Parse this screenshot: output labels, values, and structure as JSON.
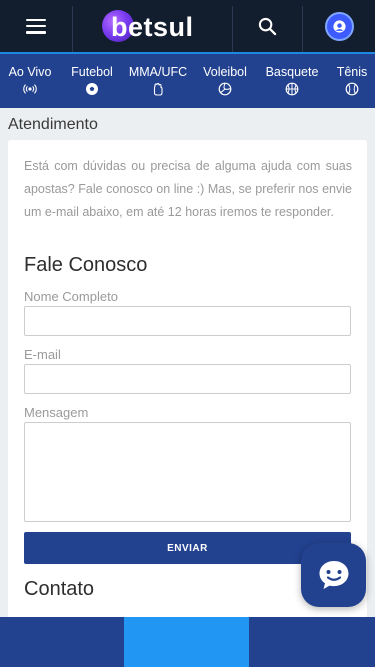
{
  "header": {
    "brand": "betsul",
    "menu_icon": "hamburger-menu-icon",
    "search_icon": "search-icon",
    "avatar_icon": "user-avatar-icon",
    "colors": {
      "background": "#121d2d",
      "accent_line": "#1e88e5",
      "avatar": "#3d5afe"
    }
  },
  "sports_nav": {
    "items": [
      {
        "label": "Ao Vivo",
        "icon": "live-broadcast-icon"
      },
      {
        "label": "Futebol",
        "icon": "soccer-ball-icon"
      },
      {
        "label": "MMA/UFC",
        "icon": "fist-icon"
      },
      {
        "label": "Voleibol",
        "icon": "volleyball-icon"
      },
      {
        "label": "Basquete",
        "icon": "basketball-icon"
      },
      {
        "label": "Tênis",
        "icon": "tennis-ball-icon"
      }
    ],
    "background": "#22418f"
  },
  "page": {
    "heading": "Atendimento",
    "intro": "Está com dúvidas ou precisa de alguma ajuda com suas apostas? Fale conosco on line :) Mas, se preferir nos envie um e-mail abaixo, em até 12 horas iremos te responder.",
    "form": {
      "title": "Fale Conosco",
      "name_label": "Nome Completo",
      "name_value": "",
      "email_label": "E-mail",
      "email_value": "",
      "message_label": "Mensagem",
      "message_value": "",
      "submit_label": "ENVIAR"
    },
    "contact_title": "Contato"
  },
  "chat_button": {
    "icon": "chat-bubble-icon"
  },
  "bottom_nav": {
    "tabs": [
      {
        "active": false
      },
      {
        "active": true
      },
      {
        "active": false
      }
    ],
    "active_color": "#2196f3"
  }
}
